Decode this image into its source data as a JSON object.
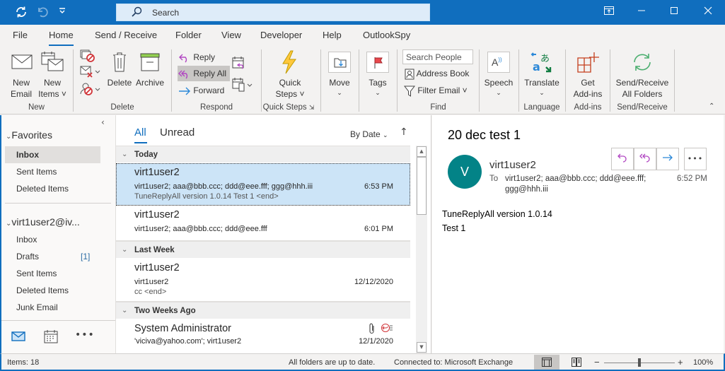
{
  "titlebar": {
    "search_placeholder": "Search",
    "icons": [
      "sync-icon",
      "undo-icon",
      "customize-qat-icon"
    ],
    "window_buttons": [
      "ribbon-display-icon",
      "minimize-icon",
      "maximize-icon",
      "close-icon"
    ]
  },
  "tabs": [
    {
      "label": "File"
    },
    {
      "label": "Home",
      "active": true
    },
    {
      "label": "Send / Receive"
    },
    {
      "label": "Folder"
    },
    {
      "label": "View"
    },
    {
      "label": "Developer"
    },
    {
      "label": "Help"
    },
    {
      "label": "OutlookSpy"
    }
  ],
  "ribbon": {
    "new": {
      "group": "New",
      "new_email": [
        "New",
        "Email"
      ],
      "new_items": [
        "New",
        "Items ˅"
      ]
    },
    "delete": {
      "group": "Delete",
      "delete": "Delete",
      "archive": "Archive"
    },
    "respond": {
      "group": "Respond",
      "reply": "Reply",
      "reply_all": "Reply All",
      "forward": "Forward"
    },
    "quick_steps": {
      "group": "Quick Steps",
      "label": [
        "Quick",
        "Steps ˅"
      ]
    },
    "move": {
      "label": "Move"
    },
    "tags": {
      "label": "Tags"
    },
    "find": {
      "group": "Find",
      "search_people_placeholder": "Search People",
      "address_book": "Address Book",
      "filter_email": "Filter Email ˅"
    },
    "speech": {
      "label": "Speech"
    },
    "language": {
      "group": "Language",
      "translate": "Translate"
    },
    "addins": {
      "group": "Add-ins",
      "get": [
        "Get",
        "Add-ins"
      ]
    },
    "sendreceive": {
      "group": "Send/Receive",
      "label": [
        "Send/Receive",
        "All Folders"
      ]
    }
  },
  "nav": {
    "favorites": {
      "header": "Favorites",
      "items": [
        {
          "label": "Inbox",
          "selected": true
        },
        {
          "label": "Sent Items"
        },
        {
          "label": "Deleted Items"
        }
      ]
    },
    "account": {
      "header": "virt1user2@iv...",
      "items": [
        {
          "label": "Inbox"
        },
        {
          "label": "Drafts",
          "count": "[1]"
        },
        {
          "label": "Sent Items"
        },
        {
          "label": "Deleted Items"
        },
        {
          "label": "Junk Email"
        }
      ]
    },
    "bottom_icons": [
      "mail-icon",
      "calendar-icon",
      "more-icon"
    ]
  },
  "list": {
    "filters": {
      "all": "All",
      "unread": "Unread"
    },
    "sort": "By Date",
    "groups": [
      {
        "label": "Today",
        "messages": [
          {
            "from": "virt1user2",
            "to": "virt1user2; aaa@bbb.ccc; ddd@eee.fff; ggg@hhh.iii",
            "preview": "TuneReplyAll version 1.0.14  Test 1 <end>",
            "time": "6:53 PM",
            "selected": true
          },
          {
            "from": "virt1user2",
            "to": "virt1user2; aaa@bbb.ccc; ddd@eee.fff",
            "preview": "",
            "time": "6:01 PM"
          }
        ]
      },
      {
        "label": "Last Week",
        "messages": [
          {
            "from": "virt1user2",
            "to": "virt1user2",
            "preview": "cc <end>",
            "time": "12/12/2020"
          }
        ]
      },
      {
        "label": "Two Weeks Ago",
        "messages": [
          {
            "from": "System Administrator",
            "to": "'viciva@yahoo.com'; virt1user2",
            "preview": "",
            "time": "12/1/2020",
            "attachment": true,
            "replied": true
          }
        ]
      }
    ]
  },
  "reading": {
    "subject": "20 dec test 1",
    "avatar_initial": "V",
    "avatar_color": "#038387",
    "sender": "virt1user2",
    "to_label": "To",
    "to_line1": "virt1user2; aaa@bbb.ccc; ddd@eee.fff;",
    "to_line2": "ggg@hhh.iii",
    "time": "6:52 PM",
    "body": [
      "TuneReplyAll version 1.0.14",
      "Test 1"
    ]
  },
  "status": {
    "items": "Items: 18",
    "sync": "All folders are up to date.",
    "connection": "Connected to: Microsoft Exchange",
    "zoom": "100%",
    "zoom_percent": 100
  },
  "colors": {
    "accent": "#106ebe",
    "reply_purple": "#b146c2",
    "forward_blue": "#2b88d8"
  }
}
